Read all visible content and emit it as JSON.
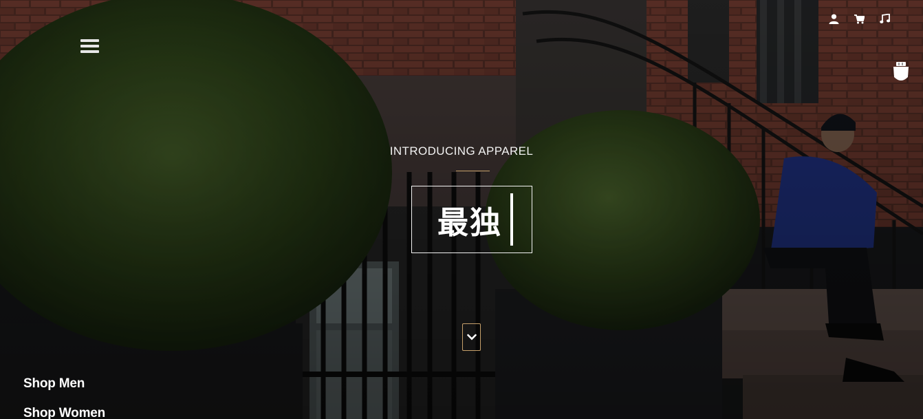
{
  "hero": {
    "intro": "INTRODUCING APPAREL",
    "headline": "最独"
  },
  "icons": {
    "menu": "hamburger-menu-icon",
    "account": "user-icon",
    "cart": "cart-icon",
    "music": "music-note-icon",
    "cup": "cup-icon",
    "scroll": "chevron-down-icon"
  },
  "nav": {
    "shop_men": "Shop Men",
    "shop_women": "Shop Women"
  },
  "colors": {
    "accent": "#c7a16b",
    "text": "#ffffff"
  }
}
